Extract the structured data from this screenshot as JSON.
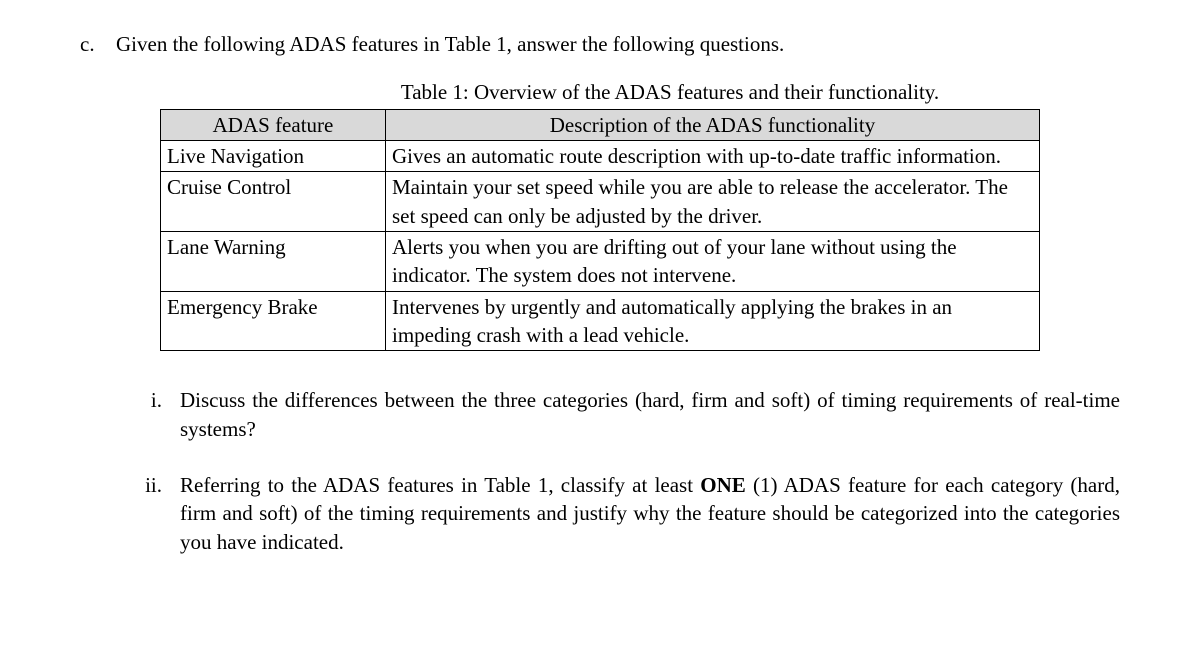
{
  "question": {
    "marker": "c.",
    "prompt": "Given the following ADAS features in Table 1, answer the following questions."
  },
  "table": {
    "caption": "Table 1: Overview of the ADAS features and their functionality.",
    "headers": {
      "feature": "ADAS feature",
      "description": "Description of the ADAS functionality"
    },
    "rows": [
      {
        "feature": "Live Navigation",
        "description": "Gives an automatic route description with up-to-date traffic information."
      },
      {
        "feature": "Cruise Control",
        "description": "Maintain your set speed while you are able to release the accelerator. The set speed can only be adjusted by the driver."
      },
      {
        "feature": "Lane Warning",
        "description": "Alerts you when you are drifting out of your lane without using the indicator. The system does not intervene."
      },
      {
        "feature": "Emergency Brake",
        "description": "Intervenes by urgently and automatically applying the brakes in an impeding crash with a lead vehicle."
      }
    ]
  },
  "subquestions": [
    {
      "marker": "i.",
      "text": "Discuss the differences between the three categories (hard, firm and soft) of timing requirements of real-time systems?"
    },
    {
      "marker": "ii.",
      "text_before": "Referring to the ADAS features in Table 1, classify at least ",
      "bold": "ONE",
      "text_after": " (1) ADAS feature for each category (hard, firm and soft) of the timing requirements and justify why the feature should be categorized into the categories you have indicated."
    }
  ]
}
